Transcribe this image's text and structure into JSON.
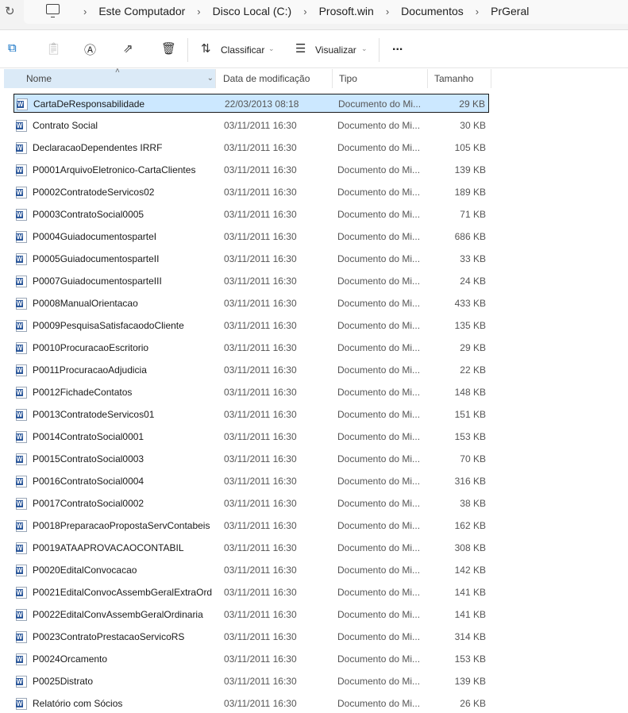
{
  "breadcrumb": [
    "Este Computador",
    "Disco Local (C:)",
    "Prosoft.win",
    "Documentos",
    "PrGeral"
  ],
  "toolbar": {
    "sort_label": "Classificar",
    "view_label": "Visualizar",
    "more_label": "..."
  },
  "columns": {
    "name": "Nome",
    "date": "Data de modificação",
    "type": "Tipo",
    "size": "Tamanho"
  },
  "files": [
    {
      "name": "CartaDeResponsabilidade",
      "date": "22/03/2013 08:18",
      "type": "Documento do Mi...",
      "size": "29 KB"
    },
    {
      "name": "Contrato Social",
      "date": "03/11/2011 16:30",
      "type": "Documento do Mi...",
      "size": "30 KB"
    },
    {
      "name": "DeclaracaoDependentes IRRF",
      "date": "03/11/2011 16:30",
      "type": "Documento do Mi...",
      "size": "105 KB"
    },
    {
      "name": "P0001ArquivoEletronico-CartaClientes",
      "date": "03/11/2011 16:30",
      "type": "Documento do Mi...",
      "size": "139 KB"
    },
    {
      "name": "P0002ContratodeServicos02",
      "date": "03/11/2011 16:30",
      "type": "Documento do Mi...",
      "size": "189 KB"
    },
    {
      "name": "P0003ContratoSocial0005",
      "date": "03/11/2011 16:30",
      "type": "Documento do Mi...",
      "size": "71 KB"
    },
    {
      "name": "P0004GuiadocumentospartеI",
      "date": "03/11/2011 16:30",
      "type": "Documento do Mi...",
      "size": "686 KB"
    },
    {
      "name": "P0005GuiadocumentospartеII",
      "date": "03/11/2011 16:30",
      "type": "Documento do Mi...",
      "size": "33 KB"
    },
    {
      "name": "P0007GuiadocumentospartеIII",
      "date": "03/11/2011 16:30",
      "type": "Documento do Mi...",
      "size": "24 KB"
    },
    {
      "name": "P0008ManualOrientacao",
      "date": "03/11/2011 16:30",
      "type": "Documento do Mi...",
      "size": "433 KB"
    },
    {
      "name": "P0009PesquisaSatisfacaodoCliente",
      "date": "03/11/2011 16:30",
      "type": "Documento do Mi...",
      "size": "135 KB"
    },
    {
      "name": "P0010ProcuracaoEscritorio",
      "date": "03/11/2011 16:30",
      "type": "Documento do Mi...",
      "size": "29 KB"
    },
    {
      "name": "P0011ProcuracaoAdjudicia",
      "date": "03/11/2011 16:30",
      "type": "Documento do Mi...",
      "size": "22 KB"
    },
    {
      "name": "P0012FichadeContatos",
      "date": "03/11/2011 16:30",
      "type": "Documento do Mi...",
      "size": "148 KB"
    },
    {
      "name": "P0013ContratodeServicos01",
      "date": "03/11/2011 16:30",
      "type": "Documento do Mi...",
      "size": "151 KB"
    },
    {
      "name": "P0014ContratoSocial0001",
      "date": "03/11/2011 16:30",
      "type": "Documento do Mi...",
      "size": "153 KB"
    },
    {
      "name": "P0015ContratoSocial0003",
      "date": "03/11/2011 16:30",
      "type": "Documento do Mi...",
      "size": "70 KB"
    },
    {
      "name": "P0016ContratoSocial0004",
      "date": "03/11/2011 16:30",
      "type": "Documento do Mi...",
      "size": "316 KB"
    },
    {
      "name": "P0017ContratoSocial0002",
      "date": "03/11/2011 16:30",
      "type": "Documento do Mi...",
      "size": "38 KB"
    },
    {
      "name": "P0018PreparacaoPropostaServContabeis",
      "date": "03/11/2011 16:30",
      "type": "Documento do Mi...",
      "size": "162 KB"
    },
    {
      "name": "P0019ATAAPROVACAOCONTABIL",
      "date": "03/11/2011 16:30",
      "type": "Documento do Mi...",
      "size": "308 KB"
    },
    {
      "name": "P0020EditalConvocacao",
      "date": "03/11/2011 16:30",
      "type": "Documento do Mi...",
      "size": "142 KB"
    },
    {
      "name": "P0021EditalConvocAssembGeralExtraOrd",
      "date": "03/11/2011 16:30",
      "type": "Documento do Mi...",
      "size": "141 KB"
    },
    {
      "name": "P0022EditalConvAssembGeralOrdinaria",
      "date": "03/11/2011 16:30",
      "type": "Documento do Mi...",
      "size": "141 KB"
    },
    {
      "name": "P0023ContratoPrestacaoServicoRS",
      "date": "03/11/2011 16:30",
      "type": "Documento do Mi...",
      "size": "314 KB"
    },
    {
      "name": "P0024Orcamento",
      "date": "03/11/2011 16:30",
      "type": "Documento do Mi...",
      "size": "153 KB"
    },
    {
      "name": "P0025Distrato",
      "date": "03/11/2011 16:30",
      "type": "Documento do Mi...",
      "size": "139 KB"
    },
    {
      "name": "Relatório com Sócios",
      "date": "03/11/2011 16:30",
      "type": "Documento do Mi...",
      "size": "26 KB"
    }
  ]
}
